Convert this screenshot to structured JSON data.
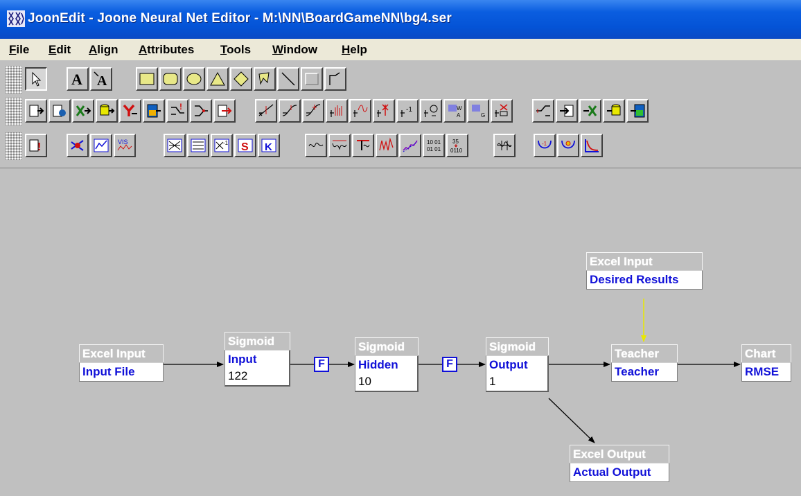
{
  "window": {
    "title": "JoonEdit - Joone Neural Net Editor - M:\\NN\\BoardGameNN\\bg4.ser"
  },
  "menu": [
    {
      "label": "File",
      "mnemonic": "F",
      "rest": "ile"
    },
    {
      "label": "Edit",
      "mnemonic": "E",
      "rest": "dit"
    },
    {
      "label": "Align",
      "mnemonic": "A",
      "rest": "lign"
    },
    {
      "label": "Attributes",
      "mnemonic": "A",
      "rest": "ttributes"
    },
    {
      "label": "Tools",
      "mnemonic": "T",
      "rest": "ools"
    },
    {
      "label": "Window",
      "mnemonic": "W",
      "rest": "indow"
    },
    {
      "label": "Help",
      "mnemonic": "H",
      "rest": "elp"
    }
  ],
  "toolbars": {
    "row1": [
      "selection-tool",
      "text-tool",
      "connected-text-tool",
      "rectangle-tool",
      "round-rectangle-tool",
      "ellipse-tool",
      "triangle-tool",
      "diamond-tool",
      "polygon-tool",
      "line-tool",
      "border-tool",
      "elbow-connection-tool"
    ],
    "row2": [
      "file-input",
      "url-input",
      "xls-input",
      "jdbc-input",
      "yahoo-input",
      "image-input",
      "switch-input",
      "learning-switch",
      "input-connector",
      "linear-layer",
      "sigmoid-layer",
      "tanh-layer",
      "log-layer",
      "sine-layer",
      "gaussian-layer",
      "delay-layer",
      "context-layer",
      "winner-take-all-layer",
      "gaussian-layer-2d",
      "nested-neural-net",
      "output-switch",
      "file-output",
      "excel-output",
      "jdbc-output",
      "image-output"
    ],
    "row3": [
      "teacher",
      "kohonen-synapse",
      "chart-output",
      "visad-output",
      "full-synapse",
      "direct-synapse",
      "delayed-synapse",
      "sanger-synapse",
      "kohonen-synapse-2",
      "normalizer-plugin",
      "turning-points",
      "delta-norm",
      "shuffle-plugin",
      "moving-average",
      "binary-plugin",
      "unnormalizer",
      "center-zero",
      "min-max-extractor",
      "chart-handle",
      "rmse-plugin"
    ]
  },
  "canvas": {
    "nodes": {
      "excel_input": {
        "type": "Excel Input",
        "name": "Input File"
      },
      "desired": {
        "type": "Excel Input",
        "name": "Desired Results"
      },
      "input_layer": {
        "type": "Sigmoid",
        "name": "Input",
        "count": "122"
      },
      "hidden_layer": {
        "type": "Sigmoid",
        "name": "Hidden",
        "count": "10"
      },
      "output_layer": {
        "type": "Sigmoid",
        "name": "Output",
        "count": "1"
      },
      "teacher": {
        "type": "Teacher",
        "name": "Teacher"
      },
      "chart": {
        "type": "Chart",
        "name": "RMSE"
      },
      "excel_output": {
        "type": "Excel Output",
        "name": "Actual Output"
      }
    },
    "synapses": {
      "input_hidden": "F",
      "hidden_output": "F"
    },
    "colors": {
      "connector": "#000000",
      "desired_connector": "#e8e800",
      "node_name": "#1010d8"
    }
  }
}
